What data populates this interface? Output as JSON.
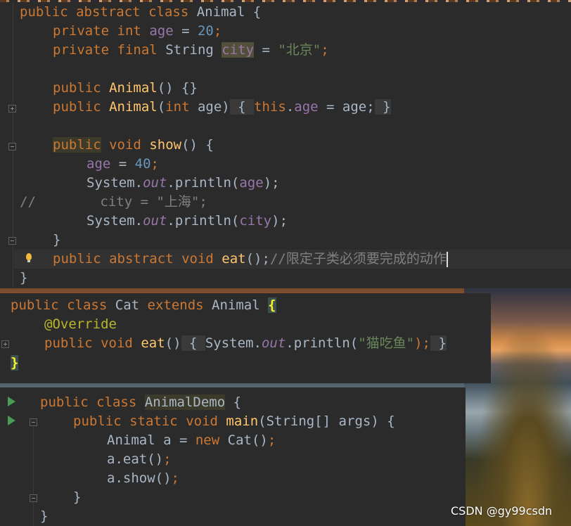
{
  "animal_panel": {
    "l1": {
      "t1": "public",
      "t2": "abstract",
      "t3": "class",
      "t4": "Animal {"
    },
    "l2": {
      "t1": "private",
      "t2": "int",
      "t3": "age",
      "t4": " = ",
      "t5": "20",
      "t6": ";"
    },
    "l3": {
      "t1": "private",
      "t2": "final",
      "t3": "String ",
      "t4": "city",
      "t5": " = ",
      "t6": "\"北京\"",
      "t7": ";"
    },
    "l5": {
      "t1": "public",
      "t2": "Animal",
      "t3": "() {}"
    },
    "l6": {
      "t1": "public",
      "t2": "Animal",
      "t3": "(",
      "t4": "int",
      "t5": " age)",
      "t6": " { ",
      "t7": "this",
      "t8": ".",
      "t9": "age",
      "t10": " = age;",
      "t11": " }"
    },
    "l8": {
      "t1": "public",
      "t2": "void",
      "t3": "show",
      "t4": "() {"
    },
    "l9": {
      "t1": "age",
      "t2": " = ",
      "t3": "40",
      "t4": ";"
    },
    "l10": {
      "t1": "System.",
      "t2": "out",
      "t3": ".println(",
      "t4": "age",
      "t5": ");"
    },
    "l11": {
      "t1": "//        city = \"上海\";"
    },
    "l12": {
      "t1": "System.",
      "t2": "out",
      "t3": ".println(",
      "t4": "city",
      "t5": ");"
    },
    "l13": {
      "t1": "}"
    },
    "l14": {
      "t1": "public",
      "t2": "abstract",
      "t3": "void",
      "t4": "eat",
      "t5": "();",
      "t6": "//限定子类必须要完成的动作"
    },
    "l15": {
      "t1": "}"
    }
  },
  "cat_panel": {
    "l1": {
      "t1": "public",
      "t2": "class",
      "t3": "Cat ",
      "t4": "extends",
      "t5": "Animal ",
      "t6": "{"
    },
    "l2": {
      "t1": "@Override"
    },
    "l3": {
      "t1": "public",
      "t2": "void",
      "t3": "eat",
      "t4": "()",
      "t5": " { ",
      "t6": "System.",
      "t7": "out",
      "t8": ".println(",
      "t9": "\"猫吃鱼\"",
      "t10": ");",
      "t11": " }"
    },
    "l4": {
      "t1": "}"
    }
  },
  "demo_panel": {
    "l1": {
      "t1": "public",
      "t2": "class",
      "t3": "AnimalDemo",
      "t4": " {"
    },
    "l2": {
      "t1": "public",
      "t2": "static",
      "t3": "void",
      "t4": "main",
      "t5": "(String[] args) {"
    },
    "l3": {
      "t1": "Animal a = ",
      "t2": "new",
      "t3": "Cat()",
      "t4": ";"
    },
    "l4": {
      "t1": "a.eat()",
      "t2": ";"
    },
    "l5": {
      "t1": "a.show()",
      "t2": ";"
    },
    "l6": {
      "t1": "}"
    },
    "l7": {
      "t1": "}"
    }
  },
  "watermark": "CSDN @gy99csdn",
  "colors": {
    "keyword": "#cc7832",
    "function": "#ffc66d",
    "field": "#9876aa",
    "number": "#6897bb",
    "string": "#6a8759",
    "comment": "#808080",
    "annotation": "#bbb529",
    "text": "#a9b7c6",
    "run": "#499c54"
  },
  "icons": [
    "run-icon",
    "fold-icon",
    "intention-bulb-icon"
  ]
}
